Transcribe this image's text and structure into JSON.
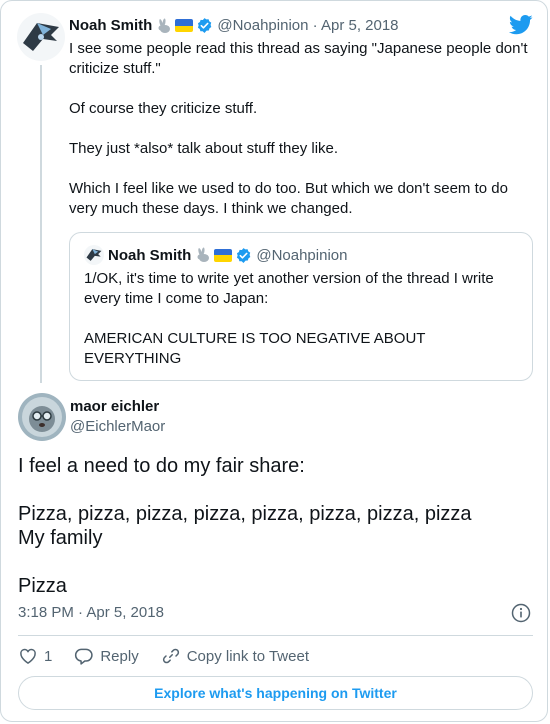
{
  "quoted_parent": {
    "author_name": "Noah Smith",
    "author_emoji": [
      "rabbit-icon",
      "ukraine-flag-icon",
      "verified-badge-icon"
    ],
    "handle_date": "@Noahpinion · Apr 5, 2018",
    "paragraphs": [
      "I see some people read this thread as saying \"Japanese people don't criticize stuff.\"",
      "Of course they criticize stuff.",
      "They just *also* talk about stuff they like.",
      "Which I feel like we used to do too. But which we don't seem to do very much these days. I think we changed."
    ],
    "quote": {
      "author_name": "Noah Smith",
      "handle": "@Noahpinion",
      "paragraphs": [
        "1/OK, it's time to write yet another version of the thread I write every time I come to Japan:",
        "AMERICAN CULTURE IS TOO NEGATIVE ABOUT EVERYTHING"
      ]
    }
  },
  "main_tweet": {
    "author_name": "maor eichler",
    "handle": "@EichlerMaor",
    "lines": [
      "I feel a need to do my fair share:",
      "",
      "Pizza, pizza, pizza, pizza, pizza, pizza, pizza, pizza",
      "My family",
      "",
      "Pizza"
    ],
    "timestamp": "3:18 PM · Apr 5, 2018"
  },
  "actions": {
    "like_count": "1",
    "reply_label": "Reply",
    "copy_label": "Copy link to Tweet"
  },
  "explore_label": "Explore what's happening on Twitter",
  "colors": {
    "accent": "#1d9bf0",
    "muted": "#536471",
    "border": "#cfd9de",
    "like": "#536471"
  }
}
